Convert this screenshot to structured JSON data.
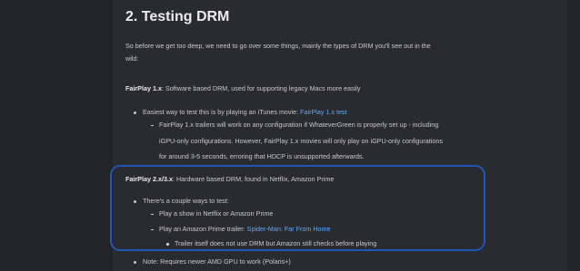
{
  "section_title": "2. Testing DRM",
  "intro": {
    "line1": "So before we get too deep, we need to go over some things, mainly the types of DRM you'll see out in the",
    "line2": "wild:"
  },
  "fairplay1": {
    "name": "FairPlay 1.x",
    "desc": ": Software based DRM, used for supporting legacy Macs more easily",
    "bullet": {
      "text": "Easiest way to test this is by playing an iTunes movie: ",
      "link": "FairPlay 1.x test"
    },
    "sub": {
      "line1": "FairPlay 1.x trailers will work on any configuration if WhateverGreen is properly set up - including",
      "line2": "iGPU-only configurations. However, FairPlay 1.x movies will only play on iGPU-only configurations",
      "line3": "for around 3-5 seconds, erroring that HDCP is unsupported afterwards."
    }
  },
  "fairplay2": {
    "name": "FairPlay 2.x/3.x",
    "desc": ": Hardware based DRM, found in Netflix, Amazon Prime",
    "bullet": "There's a couple ways to test:",
    "sub1": "Play a show in Netflix or Amazon Prime",
    "sub2": {
      "text": "Play an Amazon Prime trailer: ",
      "link": "Spider-Man: Far From Home"
    },
    "subsub": "Trailer itself does not use DRM but Amazon still checks before playing"
  },
  "note": "Note: Requires newer AMD GPU to work (Polaris+)",
  "colors": {
    "background": "#2a2b2e",
    "text": "#c9c9c9",
    "link": "#5fa8ff",
    "highlight_border": "#1e57b8"
  }
}
